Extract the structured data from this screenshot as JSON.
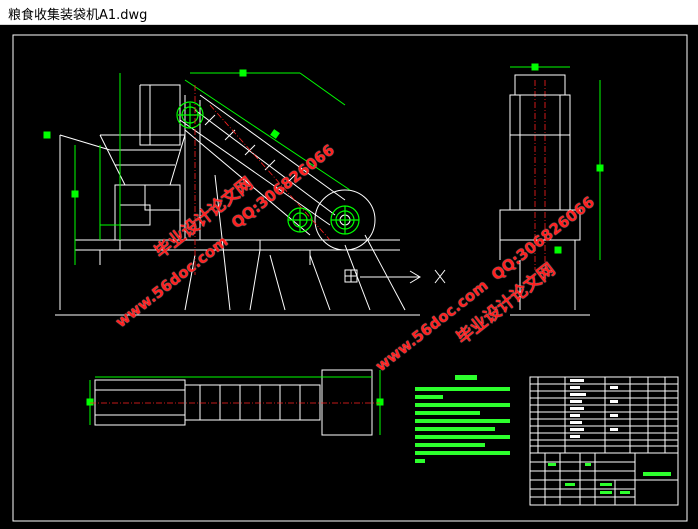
{
  "window": {
    "title": "粮食收集装袋机A1.dwg"
  },
  "watermarks": [
    {
      "text": "毕业设计论文网",
      "color": "#ff2020"
    },
    {
      "text": "www.56doc.com",
      "color": "#ff2020"
    },
    {
      "text": "QQ:306826066",
      "color": "#ff2020"
    },
    {
      "text": "QQ:306826066",
      "color": "#ff2020"
    },
    {
      "text": "www.56doc.com",
      "color": "#ff2020"
    },
    {
      "text": "毕业设计论文网",
      "color": "#ff2020"
    }
  ],
  "colors": {
    "background": "#000000",
    "line": "#ffffff",
    "green": "#00ff00",
    "red": "#ff2020",
    "accent_green": "#2dff2d"
  }
}
